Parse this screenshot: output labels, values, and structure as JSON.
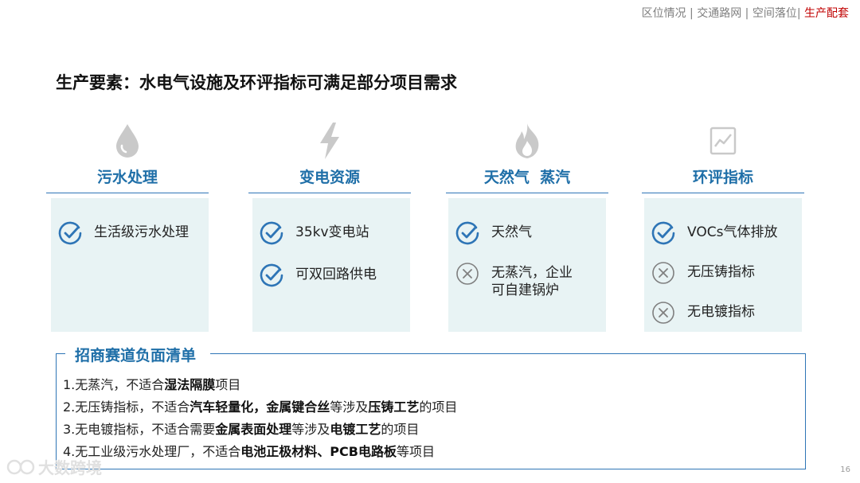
{
  "nav": {
    "items": [
      "区位情况",
      "交通路网",
      "空间落位",
      "生产配套"
    ],
    "active_index": 3,
    "separator": "|",
    "color_default": "#7f7f7f",
    "color_active": "#c00000"
  },
  "page_title": "生产要素：水电气设施及环评指标可满足部分项目需求",
  "accent_color": "#1f6fa8",
  "card_color": "#e8f3f4",
  "columns": [
    {
      "title": "污水处理",
      "icon": "water-drop-icon",
      "items": [
        {
          "status": "check",
          "text": "生活级污水处理"
        }
      ]
    },
    {
      "title": "变电资源",
      "icon": "lightning-icon",
      "items": [
        {
          "status": "check",
          "text": "35kv变电站"
        },
        {
          "status": "check",
          "text": "可双回路供电"
        }
      ]
    },
    {
      "title": "天然气  蒸汽",
      "icon": "flame-icon",
      "items": [
        {
          "status": "check",
          "text": "天然气"
        },
        {
          "status": "cross",
          "text": "无蒸汽，企业\n可自建锅炉"
        }
      ]
    },
    {
      "title": "环评指标",
      "icon": "chart-icon",
      "items": [
        {
          "status": "check",
          "text": "VOCs气体排放"
        },
        {
          "status": "cross",
          "text": "无压铸指标"
        },
        {
          "status": "cross",
          "text": "无电镀指标"
        }
      ]
    }
  ],
  "negative_list": {
    "title": "招商赛道负面清单",
    "lines": [
      [
        {
          "t": "1.无蒸汽，不适合"
        },
        {
          "t": "湿法隔膜",
          "b": true
        },
        {
          "t": "项目"
        }
      ],
      [
        {
          "t": "2.无压铸指标，不适合"
        },
        {
          "t": "汽车轻量化，金属键合丝",
          "b": true
        },
        {
          "t": "等涉及"
        },
        {
          "t": "压铸工艺",
          "b": true
        },
        {
          "t": "的项目"
        }
      ],
      [
        {
          "t": "3.无电镀指标，不适合需要"
        },
        {
          "t": "金属表面处理",
          "b": true
        },
        {
          "t": "等涉及"
        },
        {
          "t": "电镀工艺",
          "b": true
        },
        {
          "t": "的项目"
        }
      ],
      [
        {
          "t": "4.无工业级污水处理厂，不适合"
        },
        {
          "t": "电池正极材料、PCB电路板",
          "b": true
        },
        {
          "t": "等项目"
        }
      ]
    ]
  },
  "watermark": "大数跨境",
  "page_number": "16"
}
